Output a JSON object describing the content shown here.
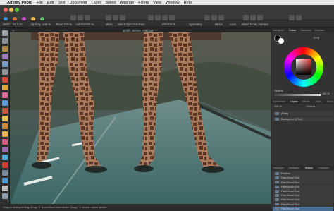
{
  "menubar": {
    "apple_icon": "apple-icon",
    "items": [
      "Affinity Photo",
      "File",
      "Edit",
      "Text",
      "Document",
      "Layer",
      "Select",
      "Arrange",
      "Filters",
      "View",
      "Window",
      "Help"
    ]
  },
  "toolbar": {
    "traffic_colors": {
      "close": "#ee5f57",
      "minimize": "#f5bd4f",
      "zoom": "#5fc43f"
    },
    "persona_icons": [
      "photo-persona-icon",
      "liquify-persona-icon",
      "develop-persona-icon",
      "tone-mapping-persona-icon",
      "export-persona-icon"
    ]
  },
  "context_toolbar": {
    "width_label": "Width",
    "width_value": "81.2 px",
    "opacity_label": "Opacity",
    "opacity_value": "100 %",
    "flow_label": "Flow",
    "flow_value": "100 %",
    "hardness_label": "Hardness",
    "hardness_value": "0 %",
    "more_label": "More",
    "wet_edges_label": "Wet Edges",
    "stabiliser_label": "Stabiliser",
    "window_label": "Window",
    "window_value": "5",
    "symmetry_label": "Symmetry",
    "mirror_label": "Mirror",
    "lock_label": "Lock",
    "blend_mode_label": "Blend Mode",
    "blend_mode_value": "Normal"
  },
  "document": {
    "tab_title": "giraffe_before_road.jpg",
    "close_icon": "close-icon"
  },
  "tools": [
    {
      "name": "move-tool-icon",
      "color": "#9aa0a8"
    },
    {
      "name": "view-tool-icon",
      "color": "#8b9198"
    },
    {
      "name": "crop-tool-icon",
      "color": "#b08e4a"
    },
    {
      "name": "selection-brush-icon",
      "color": "#9a7ab8"
    },
    {
      "name": "flood-select-icon",
      "color": "#7aa0c8"
    },
    {
      "name": "marquee-icon",
      "color": "#8d939a"
    },
    {
      "name": "color-picker-icon",
      "color": "#d4483a"
    },
    {
      "name": "paint-brush-icon",
      "color": "#e8a43a"
    },
    {
      "name": "erase-brush-icon",
      "color": "#d86a9a"
    },
    {
      "name": "flood-fill-icon",
      "color": "#5b9bd5"
    },
    {
      "name": "gradient-icon",
      "color": "#c85a3c"
    },
    {
      "name": "dodge-icon",
      "color": "#e5c04a"
    },
    {
      "name": "burn-icon",
      "color": "#d8893a"
    },
    {
      "name": "sponge-icon",
      "color": "#e8b04a"
    },
    {
      "name": "clone-brush-icon",
      "color": "#d45a7a"
    },
    {
      "name": "undo-brush-icon",
      "color": "#9a6ab0"
    },
    {
      "name": "inpainting-icon",
      "color": "#4aa8d8"
    },
    {
      "name": "red-eye-icon",
      "color": "#d83a3a"
    },
    {
      "name": "pen-tool-icon",
      "color": "#7a8a9a"
    },
    {
      "name": "shape-tool-icon",
      "color": "#4a9ad8"
    },
    {
      "name": "text-tool-icon",
      "color": "#bfbfbf"
    },
    {
      "name": "zoom-tool-icon",
      "color": "#8a9aa8"
    }
  ],
  "panel": {
    "top_tabs": [
      "Histogram",
      "Colour",
      "Swatches",
      "Brushes"
    ],
    "active_top_tab": "Colour",
    "color_mode": "RGB",
    "opacity_label": "Opacity",
    "opacity_value": "100 %",
    "layer_tabs": [
      "Adjustment",
      "Layers",
      "Effects",
      "Styles",
      "Stock"
    ],
    "active_layer_tab": "Layers",
    "layer_opacity_value": "100 %",
    "layer_blend_value": "Normal",
    "layers": [
      {
        "label": "(Pixel)",
        "selected": false
      },
      {
        "label": "Background (Pixel)",
        "selected": false
      }
    ],
    "bottom_tabs": [
      "Transform",
      "Navigator",
      "History",
      "Channels"
    ],
    "active_bottom_tab": "History",
    "history": [
      "Position",
      "Paint Brush Tool",
      "Paint Brush Tool",
      "Paint Brush Tool",
      "Paint Brush Tool",
      "Paint Brush Tool",
      "Paint Brush Tool",
      "Paint Brush Tool",
      "Paint Brush Tool"
    ],
    "selected_history_index": 8
  },
  "statusbar": {
    "text": "Drag to start painting. Drag+⇧ to continue last stroke. Drag+⌥ to use colour picker."
  }
}
